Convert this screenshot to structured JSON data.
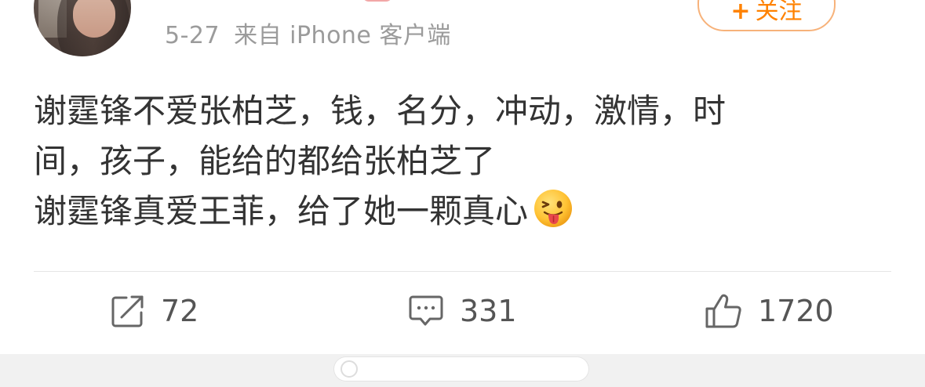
{
  "header": {
    "avatar_icon": "user-avatar-photo",
    "date": "5-27",
    "source": "来自 iPhone 客户端",
    "follow_button": {
      "plus": "+",
      "label": "关注"
    }
  },
  "post": {
    "lines": [
      "谢霆锋不爱张柏芝，钱，名分，冲动，激情，时",
      "间，孩子，能给的都给张柏芝了",
      "谢霆锋真爱王菲，给了她一颗真心"
    ],
    "emoji": "tongue-wink-emoji"
  },
  "actions": {
    "repost": {
      "icon": "share-arrow-icon",
      "count": "72"
    },
    "comment": {
      "icon": "comment-bubble-icon",
      "count": "331"
    },
    "like": {
      "icon": "thumbs-up-icon",
      "count": "1720"
    }
  },
  "colors": {
    "accent": "#ff8200",
    "meta_text": "#9b9b9b",
    "body_text": "#333333",
    "divider": "#e6e6e6"
  }
}
